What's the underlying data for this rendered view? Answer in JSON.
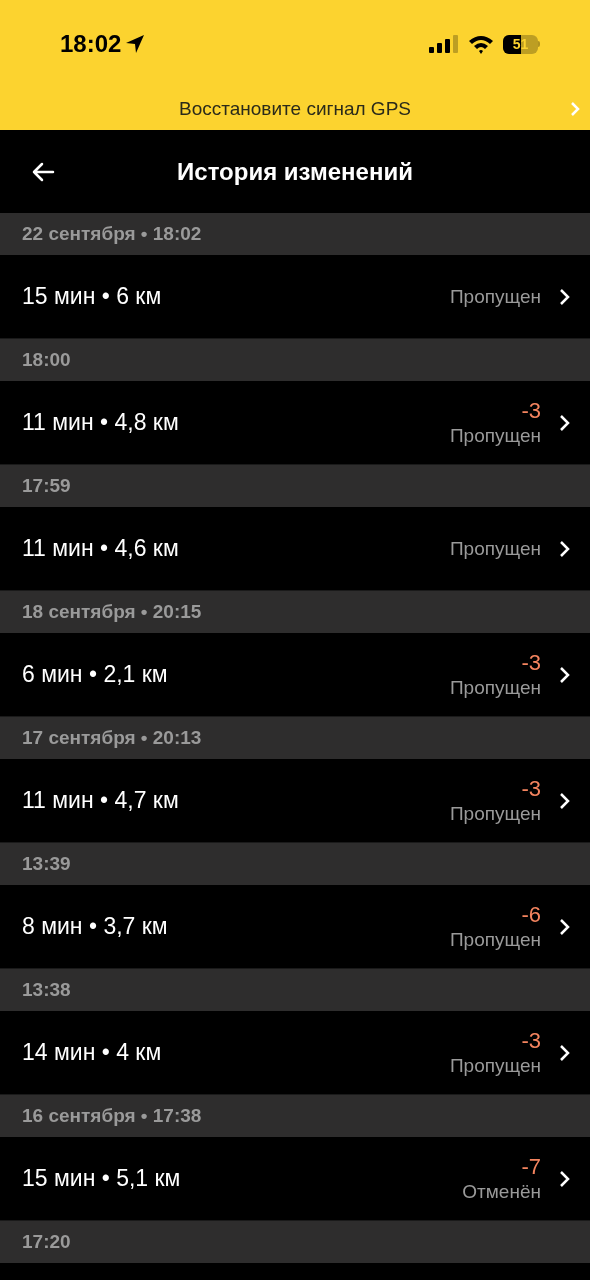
{
  "status_bar": {
    "time": "18:02",
    "battery": "51"
  },
  "banner": {
    "text": "Восстановите сигнал GPS"
  },
  "nav": {
    "title": "История изменений"
  },
  "groups": [
    {
      "header": "22 сентября • 18:02",
      "trip": "15 мин • 6 км",
      "status": "Пропущен"
    },
    {
      "header": "18:00",
      "trip": "11 мин • 4,8 км",
      "amount": "-3",
      "status": "Пропущен"
    },
    {
      "header": "17:59",
      "trip": "11 мин • 4,6 км",
      "status": "Пропущен"
    },
    {
      "header": "18 сентября • 20:15",
      "trip": "6 мин • 2,1 км",
      "amount": "-3",
      "status": "Пропущен"
    },
    {
      "header": "17 сентября • 20:13",
      "trip": "11 мин • 4,7 км",
      "amount": "-3",
      "status": "Пропущен"
    },
    {
      "header": "13:39",
      "trip": "8 мин • 3,7 км",
      "amount": "-6",
      "status": "Пропущен"
    },
    {
      "header": "13:38",
      "trip": "14 мин • 4 км",
      "amount": "-3",
      "status": "Пропущен"
    },
    {
      "header": "16 сентября • 17:38",
      "trip": "15 мин • 5,1 км",
      "amount": "-7",
      "status": "Отменён"
    },
    {
      "header": "17:20"
    }
  ]
}
